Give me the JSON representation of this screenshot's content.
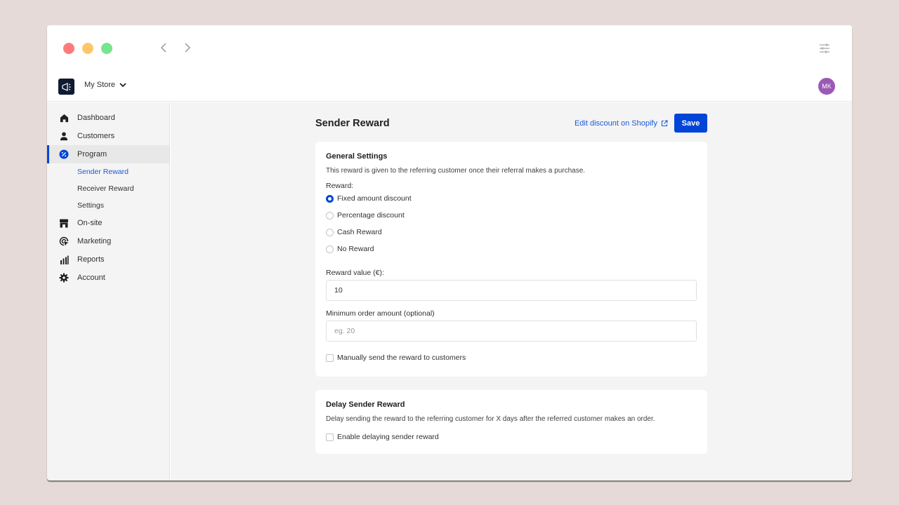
{
  "window": {
    "controls": [
      "close",
      "minimize",
      "maximize"
    ],
    "nav": {
      "back_icon": "chevron-left-icon",
      "forward_icon": "chevron-right-icon"
    },
    "settings_icon": "sliders-icon"
  },
  "topbar": {
    "logo_icon": "megaphone-icon",
    "store_name": "My Store",
    "avatar_initials": "MK"
  },
  "sidebar": {
    "items": [
      {
        "label": "Dashboard",
        "icon": "home-icon"
      },
      {
        "label": "Customers",
        "icon": "user-icon"
      },
      {
        "label": "Program",
        "icon": "discount-badge-icon",
        "active": true,
        "children": [
          {
            "label": "Sender Reward",
            "active": true
          },
          {
            "label": "Receiver Reward"
          },
          {
            "label": "Settings"
          }
        ]
      },
      {
        "label": "On-site",
        "icon": "storefront-icon"
      },
      {
        "label": "Marketing",
        "icon": "target-cursor-icon"
      },
      {
        "label": "Reports",
        "icon": "bar-chart-icon"
      },
      {
        "label": "Account",
        "icon": "gear-icon"
      }
    ]
  },
  "page": {
    "title": "Sender Reward",
    "shopify_link": "Edit discount on Shopify",
    "save_label": "Save"
  },
  "general": {
    "title": "General Settings",
    "description": "This reward is given to the referring customer once their referral makes a purchase.",
    "reward_label": "Reward:",
    "reward_options": [
      {
        "label": "Fixed amount discount",
        "checked": true
      },
      {
        "label": "Percentage discount",
        "checked": false
      },
      {
        "label": "Cash Reward",
        "checked": false
      },
      {
        "label": "No Reward",
        "checked": false
      }
    ],
    "reward_value_label": "Reward value (€):",
    "reward_value": "10",
    "min_order_label": "Minimum order amount (optional)",
    "min_order_placeholder": "eg. 20",
    "min_order_value": "",
    "manual_send_label": "Manually send the reward to customers",
    "manual_send_checked": false
  },
  "delay": {
    "title": "Delay Sender Reward",
    "description": "Delay sending the reward to the referring customer for X days after the referred customer makes an order.",
    "enable_label": "Enable delaying sender reward",
    "enable_checked": false
  },
  "colors": {
    "accent": "#0045d8",
    "link": "#1a5ad8",
    "avatar": "#9b59b6",
    "logo_bg": "#0f1b33"
  }
}
